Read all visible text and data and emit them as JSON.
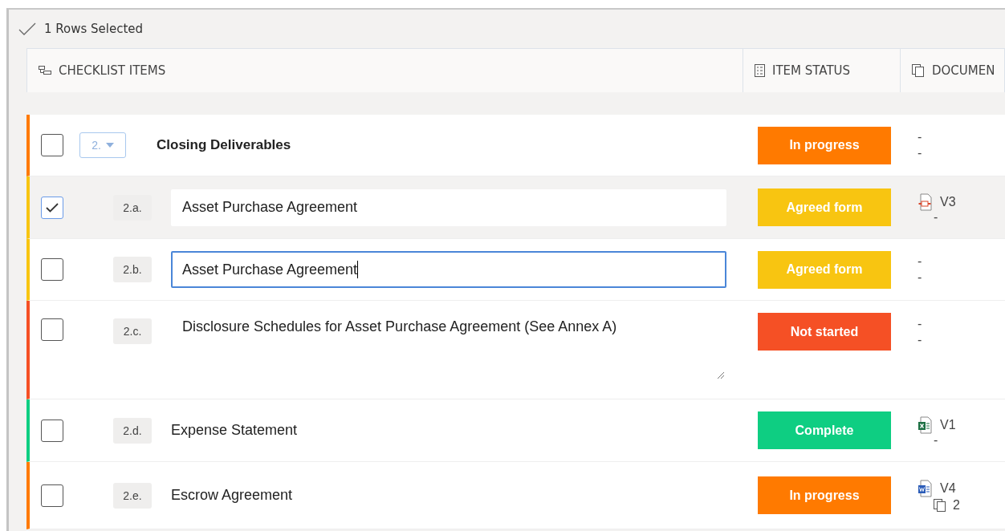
{
  "selection_bar": {
    "label": "1 Rows Selected"
  },
  "columns": [
    {
      "label": "CHECKLIST ITEMS"
    },
    {
      "label": "ITEM STATUS"
    },
    {
      "label": "DOCUMEN"
    }
  ],
  "group": {
    "number": "2.",
    "title": "Closing Deliverables",
    "checked": false,
    "status": {
      "label": "In progress",
      "color": "#ff7a00"
    },
    "documents": {
      "version": "-",
      "extra": "-"
    }
  },
  "rows": [
    {
      "number": "2.a.",
      "title": "Asset Purchase Agreement",
      "kind": "input",
      "checked": true,
      "selected": true,
      "status": {
        "label": "Agreed form",
        "color": "#f8c511"
      },
      "documents": {
        "kind": "pdf",
        "version": "V3",
        "extra": "-"
      }
    },
    {
      "number": "2.b.",
      "title": "Asset Purchase Agreement",
      "kind": "focused",
      "checked": false,
      "selected": false,
      "status": {
        "label": "Agreed form",
        "color": "#f8c511"
      },
      "documents": {
        "version": "-",
        "extra": "-"
      }
    },
    {
      "number": "2.c.",
      "title": "Disclosure Schedules for Asset Purchase Agreement (See Annex A)",
      "kind": "textarea",
      "checked": false,
      "selected": false,
      "status": {
        "label": "Not started",
        "color": "#f55025"
      },
      "documents": {
        "version": "-",
        "extra": "-"
      }
    },
    {
      "number": "2.d.",
      "title": "Expense Statement",
      "kind": "text",
      "checked": false,
      "selected": false,
      "status": {
        "label": "Complete",
        "color": "#0ece82"
      },
      "documents": {
        "kind": "spreadsheet",
        "version": "V1",
        "extra": "-"
      }
    },
    {
      "number": "2.e.",
      "title": "Escrow Agreement",
      "kind": "text",
      "checked": false,
      "selected": false,
      "status": {
        "label": "In progress",
        "color": "#ff7a00"
      },
      "documents": {
        "kind": "document",
        "version": "V4",
        "copies": "2"
      }
    }
  ]
}
